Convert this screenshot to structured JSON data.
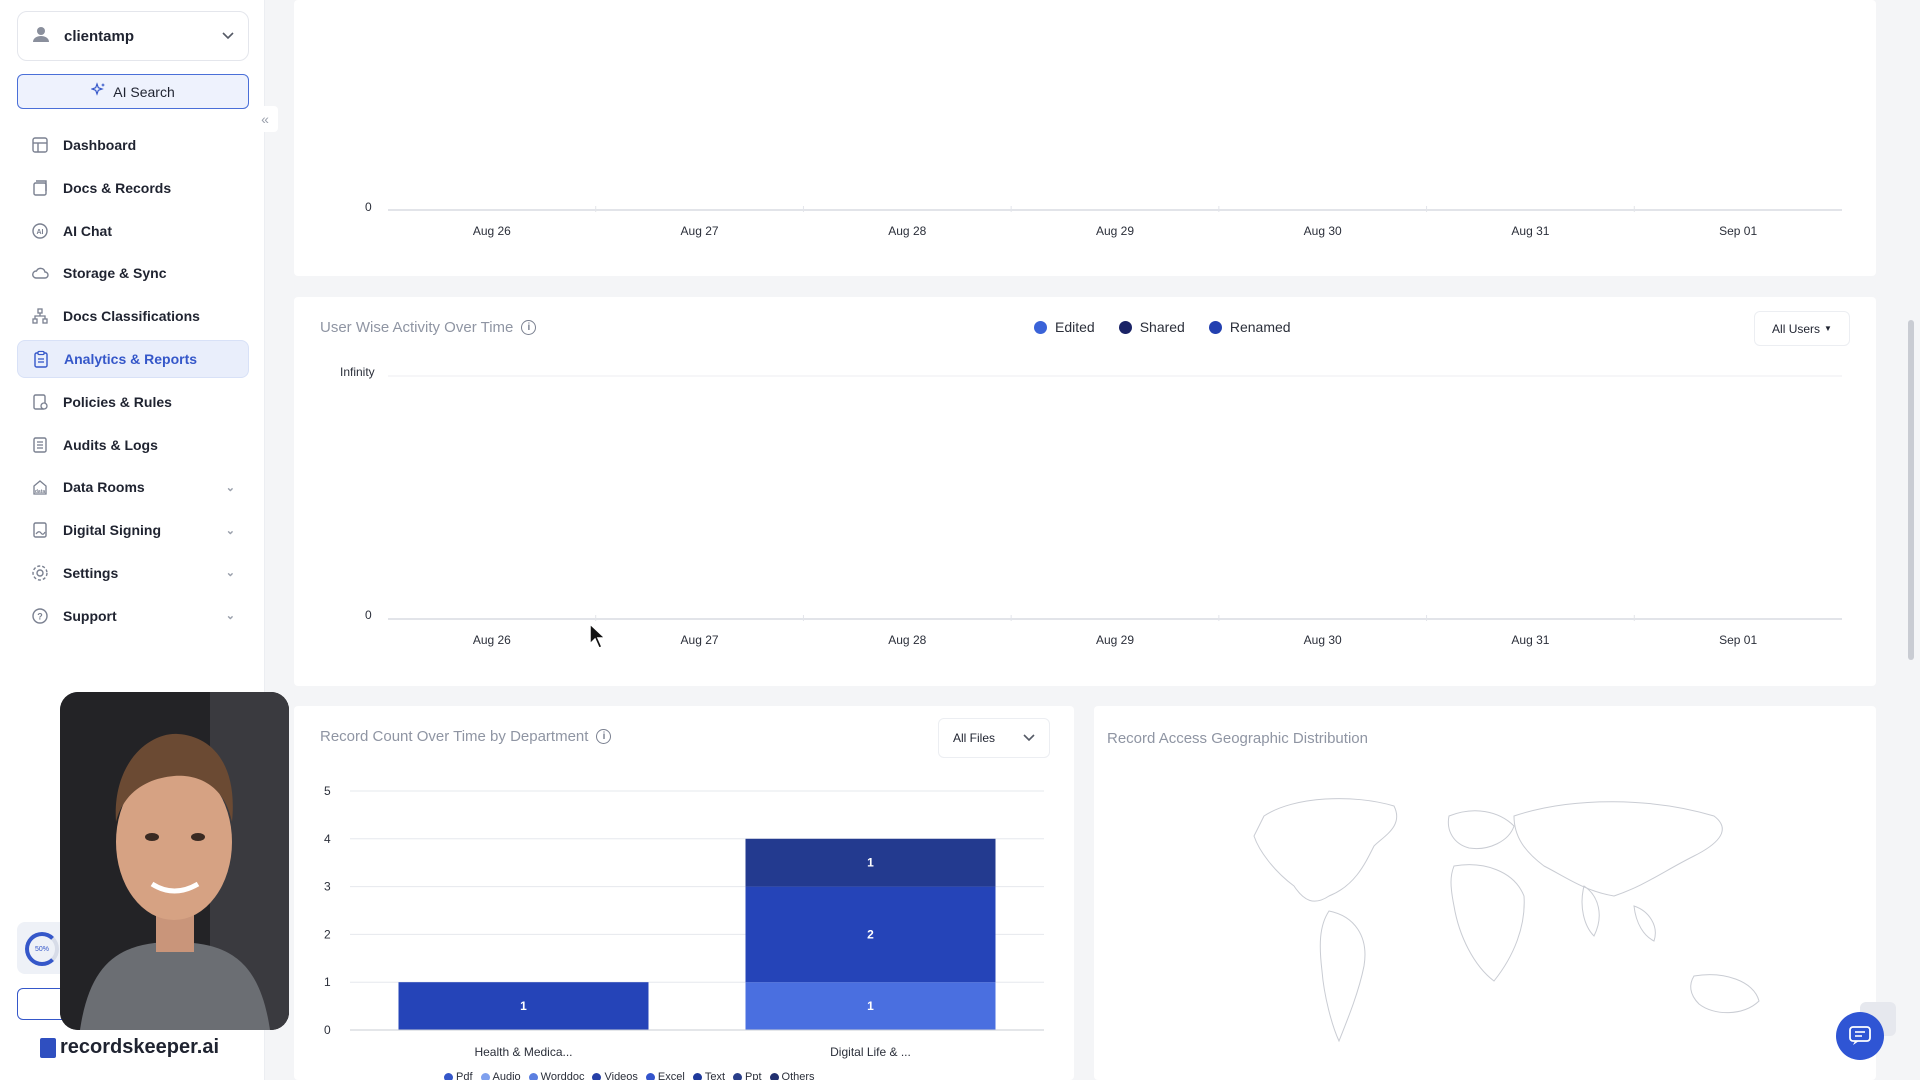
{
  "account": {
    "name": "clientamp"
  },
  "ai_search": {
    "label": "AI Search"
  },
  "nav": {
    "items": [
      {
        "label": "Dashboard",
        "icon": "dashboard-icon",
        "active": false,
        "expandable": false
      },
      {
        "label": "Docs & Records",
        "icon": "docs-icon",
        "active": false,
        "expandable": false
      },
      {
        "label": "AI Chat",
        "icon": "ai-chat-icon",
        "active": false,
        "expandable": false
      },
      {
        "label": "Storage & Sync",
        "icon": "cloud-icon",
        "active": false,
        "expandable": false
      },
      {
        "label": "Docs Classifications",
        "icon": "hierarchy-icon",
        "active": false,
        "expandable": false
      },
      {
        "label": "Analytics & Reports",
        "icon": "clipboard-icon",
        "active": true,
        "expandable": false
      },
      {
        "label": "Policies & Rules",
        "icon": "policy-icon",
        "active": false,
        "expandable": false
      },
      {
        "label": "Audits & Logs",
        "icon": "log-icon",
        "active": false,
        "expandable": false
      },
      {
        "label": "Data Rooms",
        "icon": "data-icon",
        "active": false,
        "expandable": true
      },
      {
        "label": "Digital Signing",
        "icon": "sign-icon",
        "active": false,
        "expandable": true
      },
      {
        "label": "Settings",
        "icon": "gear-icon",
        "active": false,
        "expandable": true
      },
      {
        "label": "Support",
        "icon": "help-icon",
        "active": false,
        "expandable": true
      }
    ]
  },
  "usage": {
    "percent_label": "50%"
  },
  "logo": {
    "text": "recordskeeper.ai"
  },
  "top_chart": {
    "y_zero": "0",
    "ticks": [
      "Aug 26",
      "Aug 27",
      "Aug 28",
      "Aug 29",
      "Aug 30",
      "Aug 31",
      "Sep 01"
    ]
  },
  "user_activity": {
    "title": "User Wise Activity Over Time",
    "legend": [
      {
        "label": "Edited",
        "color": "#3a63d8"
      },
      {
        "label": "Shared",
        "color": "#1a2366"
      },
      {
        "label": "Renamed",
        "color": "#2340b0"
      }
    ],
    "filter": "All Users",
    "y_top": "Infinity",
    "y_zero": "0",
    "ticks": [
      "Aug 26",
      "Aug 27",
      "Aug 28",
      "Aug 29",
      "Aug 30",
      "Aug 31",
      "Sep 01"
    ]
  },
  "record_count": {
    "title": "Record Count Over Time by Department",
    "filter": "All Files",
    "legend": [
      "Pdf",
      "Audio",
      "Worddoc",
      "Videos",
      "Excel",
      "Text",
      "Ppt",
      "Others"
    ]
  },
  "geo": {
    "title": "Record Access Geographic Distribution"
  },
  "chart_data": {
    "type": "bar",
    "stacked": true,
    "categories": [
      "Health & Medica...",
      "Digital Life & ..."
    ],
    "ylim": [
      0,
      5
    ],
    "yticks": [
      0,
      1,
      2,
      3,
      4,
      5
    ],
    "series": [
      {
        "color": "#4a6fe0",
        "values": [
          0,
          1
        ]
      },
      {
        "color": "#2544b8",
        "values": [
          1,
          2
        ]
      },
      {
        "color": "#233a8f",
        "values": [
          0,
          1
        ]
      }
    ]
  }
}
